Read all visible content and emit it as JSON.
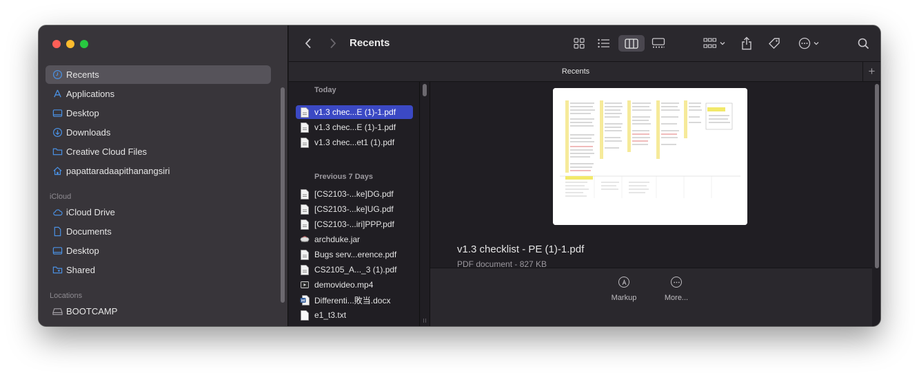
{
  "window": {
    "title": "Recents",
    "tab_label": "Recents"
  },
  "sidebar": {
    "favorites": [
      {
        "label": "Recents",
        "icon": "clock-icon",
        "selected": true
      },
      {
        "label": "Applications",
        "icon": "applications-icon"
      },
      {
        "label": "Desktop",
        "icon": "desktop-icon"
      },
      {
        "label": "Downloads",
        "icon": "download-icon"
      },
      {
        "label": "Creative Cloud Files",
        "icon": "folder-icon"
      },
      {
        "label": "papattaradaapithanangsiri",
        "icon": "home-icon"
      }
    ],
    "icloud_header": "iCloud",
    "icloud": [
      {
        "label": "iCloud Drive",
        "icon": "cloud-icon"
      },
      {
        "label": "Documents",
        "icon": "document-icon"
      },
      {
        "label": "Desktop",
        "icon": "desktop-icon"
      },
      {
        "label": "Shared",
        "icon": "shared-folder-icon"
      }
    ],
    "locations_header": "Locations",
    "locations": [
      {
        "label": "BOOTCAMP",
        "icon": "drive-icon"
      }
    ]
  },
  "files": {
    "today_header": "Today",
    "today": [
      {
        "name": "v1.3 chec...E (1)-1.pdf",
        "icon": "pdf-file-icon",
        "selected": true
      },
      {
        "name": "v1.3 chec...E (1)-1.pdf",
        "icon": "pdf-file-icon"
      },
      {
        "name": "v1.3 chec...et1 (1).pdf",
        "icon": "pdf-file-icon"
      }
    ],
    "week_header": "Previous 7 Days",
    "week": [
      {
        "name": "[CS2103-...ke]DG.pdf",
        "icon": "pdf-file-icon"
      },
      {
        "name": "[CS2103-...ke]UG.pdf",
        "icon": "pdf-file-icon"
      },
      {
        "name": "[CS2103-...iri]PPP.pdf",
        "icon": "pdf-file-icon"
      },
      {
        "name": "archduke.jar",
        "icon": "jar-file-icon"
      },
      {
        "name": "Bugs serv...erence.pdf",
        "icon": "pdf-file-icon"
      },
      {
        "name": "CS2105_A..._3 (1).pdf",
        "icon": "pdf-file-icon"
      },
      {
        "name": "demovideo.mp4",
        "icon": "video-file-icon"
      },
      {
        "name": "Differenti...敗当.docx",
        "icon": "word-file-icon"
      },
      {
        "name": "e1_t3.txt",
        "icon": "text-file-icon"
      }
    ]
  },
  "preview": {
    "filename": "v1.3 checklist - PE (1)-1.pdf",
    "meta": "PDF document - 827 KB",
    "actions": [
      {
        "label": "Markup",
        "icon": "markup-icon"
      },
      {
        "label": "More...",
        "icon": "more-icon"
      }
    ]
  },
  "colors": {
    "selection": "#3b49c4",
    "sidebar_bg": "#38353a",
    "content_bg": "#201e23",
    "close": "#fe5f57",
    "minimize": "#febc2e",
    "zoom": "#28c840"
  }
}
